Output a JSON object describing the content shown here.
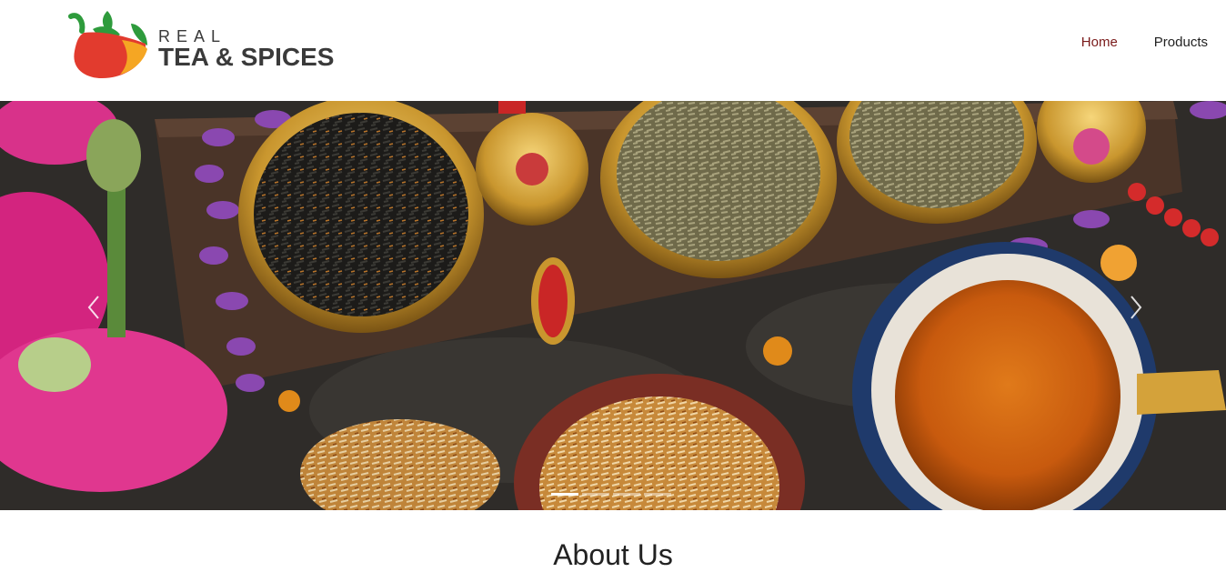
{
  "brand": {
    "line1": "REAL",
    "line2": "TEA & SPICES",
    "colors": {
      "red": "#e23b2e",
      "green": "#2e9b3c",
      "orange": "#f5a623",
      "text": "#3a3a3a"
    }
  },
  "nav": {
    "items": [
      {
        "label": "Home",
        "active": true
      },
      {
        "label": "Products",
        "active": false
      }
    ],
    "active_color": "#7a1a1a"
  },
  "carousel": {
    "prev_icon": "chevron-left-icon",
    "next_icon": "chevron-right-icon",
    "slide_count": 4,
    "active_slide": 1
  },
  "about": {
    "title": "About Us"
  }
}
